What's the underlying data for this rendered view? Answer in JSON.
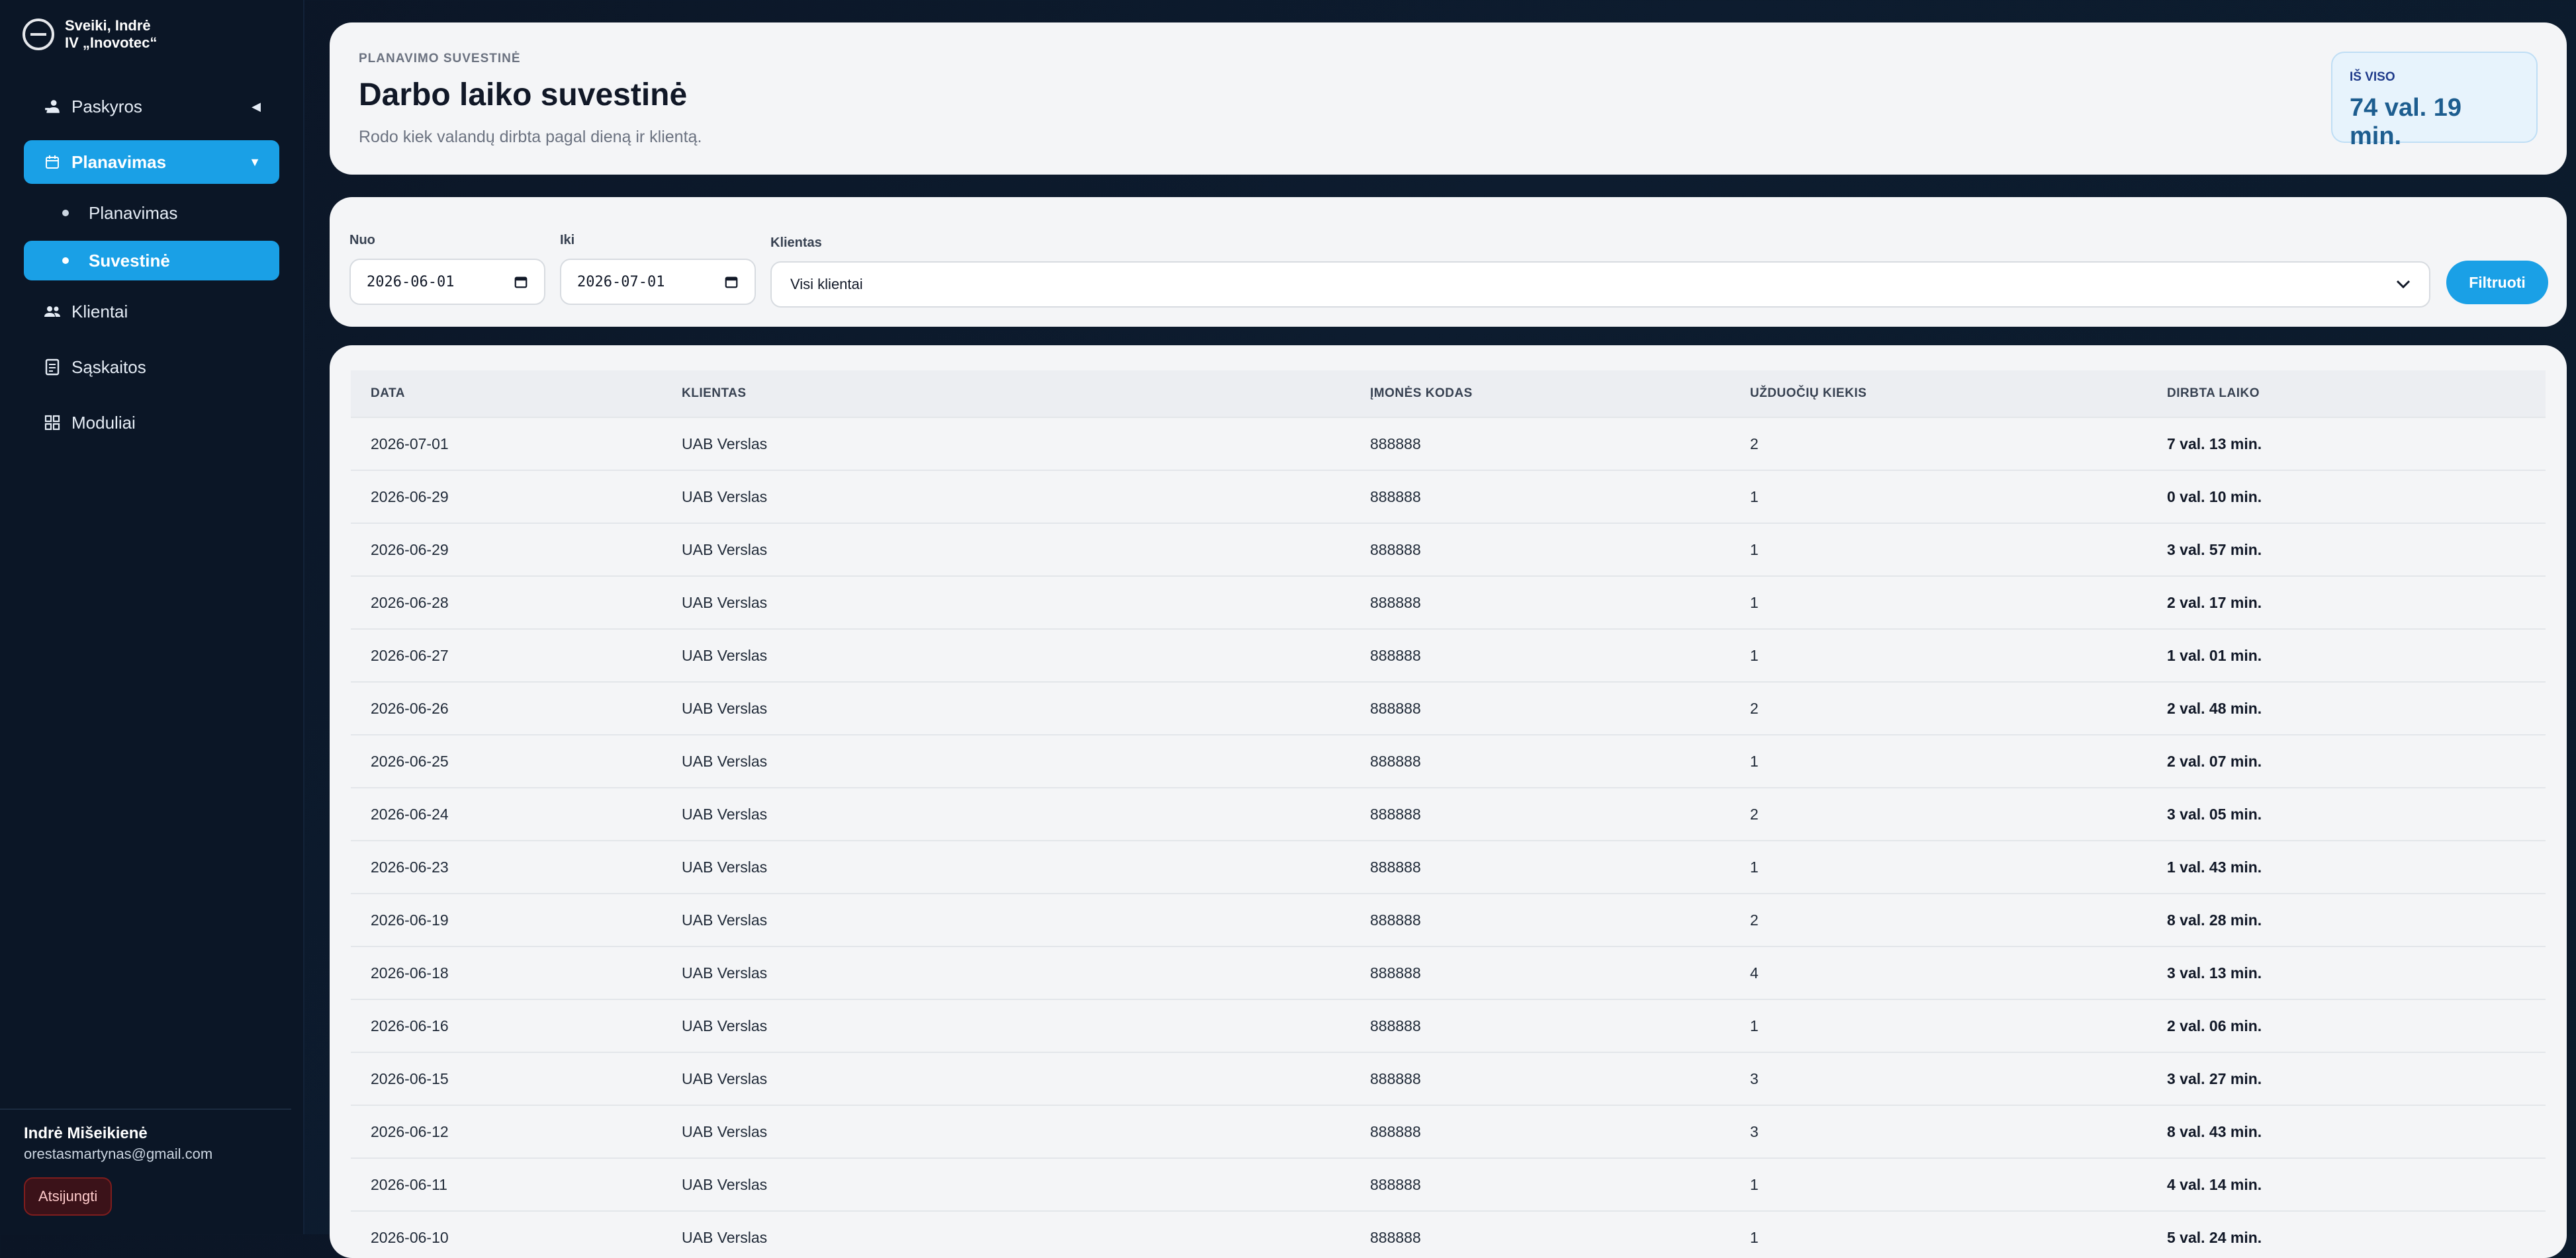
{
  "sidebar": {
    "greeting_line1": "Sveiki, Indrė",
    "greeting_line2": "IV „Inovotec“",
    "nav": {
      "paskyros": "Paskyros",
      "planavimas": "Planavimas",
      "sub_planavimas": "Planavimas",
      "sub_suvestine": "Suvestinė",
      "klientai": "Klientai",
      "saskaitos": "Sąskaitos",
      "moduliai": "Moduliai"
    },
    "user_name": "Indrė Mišeikienė",
    "user_email": "orestasmartynas@gmail.com",
    "logout_label": "Atsijungti"
  },
  "header": {
    "eyebrow": "PLANAVIMO SUVESTINĖ",
    "title": "Darbo laiko suvestinė",
    "description": "Rodo kiek valandų dirbta pagal dieną ir klientą.",
    "total_label": "IŠ VISO",
    "total_value": "74 val. 19 min."
  },
  "filters": {
    "from_label": "Nuo",
    "from_value": "2026-06-01",
    "to_label": "Iki",
    "to_value": "2026-07-01",
    "client_label": "Klientas",
    "client_value": "Visi klientai",
    "submit_label": "Filtruoti"
  },
  "table": {
    "headers": {
      "date": "DATA",
      "client": "KLIENTAS",
      "code": "ĮMONĖS KODAS",
      "tasks": "UŽDUOČIŲ KIEKIS",
      "duration": "DIRBTA LAIKO"
    },
    "rows": [
      {
        "date": "2026-07-01",
        "client": "UAB Verslas",
        "code": "888888",
        "tasks": "2",
        "duration": "7 val. 13 min."
      },
      {
        "date": "2026-06-29",
        "client": "UAB Verslas",
        "code": "888888",
        "tasks": "1",
        "duration": "0 val. 10 min."
      },
      {
        "date": "2026-06-29",
        "client": "UAB Verslas",
        "code": "888888",
        "tasks": "1",
        "duration": "3 val. 57 min."
      },
      {
        "date": "2026-06-28",
        "client": "UAB Verslas",
        "code": "888888",
        "tasks": "1",
        "duration": "2 val. 17 min."
      },
      {
        "date": "2026-06-27",
        "client": "UAB Verslas",
        "code": "888888",
        "tasks": "1",
        "duration": "1 val. 01 min."
      },
      {
        "date": "2026-06-26",
        "client": "UAB Verslas",
        "code": "888888",
        "tasks": "2",
        "duration": "2 val. 48 min."
      },
      {
        "date": "2026-06-25",
        "client": "UAB Verslas",
        "code": "888888",
        "tasks": "1",
        "duration": "2 val. 07 min."
      },
      {
        "date": "2026-06-24",
        "client": "UAB Verslas",
        "code": "888888",
        "tasks": "2",
        "duration": "3 val. 05 min."
      },
      {
        "date": "2026-06-23",
        "client": "UAB Verslas",
        "code": "888888",
        "tasks": "1",
        "duration": "1 val. 43 min."
      },
      {
        "date": "2026-06-19",
        "client": "UAB Verslas",
        "code": "888888",
        "tasks": "2",
        "duration": "8 val. 28 min."
      },
      {
        "date": "2026-06-18",
        "client": "UAB Verslas",
        "code": "888888",
        "tasks": "4",
        "duration": "3 val. 13 min."
      },
      {
        "date": "2026-06-16",
        "client": "UAB Verslas",
        "code": "888888",
        "tasks": "1",
        "duration": "2 val. 06 min."
      },
      {
        "date": "2026-06-15",
        "client": "UAB Verslas",
        "code": "888888",
        "tasks": "3",
        "duration": "3 val. 27 min."
      },
      {
        "date": "2026-06-12",
        "client": "UAB Verslas",
        "code": "888888",
        "tasks": "3",
        "duration": "8 val. 43 min."
      },
      {
        "date": "2026-06-11",
        "client": "UAB Verslas",
        "code": "888888",
        "tasks": "1",
        "duration": "4 val. 14 min."
      },
      {
        "date": "2026-06-10",
        "client": "UAB Verslas",
        "code": "888888",
        "tasks": "1",
        "duration": "5 val. 24 min."
      }
    ]
  },
  "colors": {
    "accent": "#1aa0e6",
    "sidebar_bg": "#0b1626",
    "card_bg": "#f4f5f7"
  }
}
